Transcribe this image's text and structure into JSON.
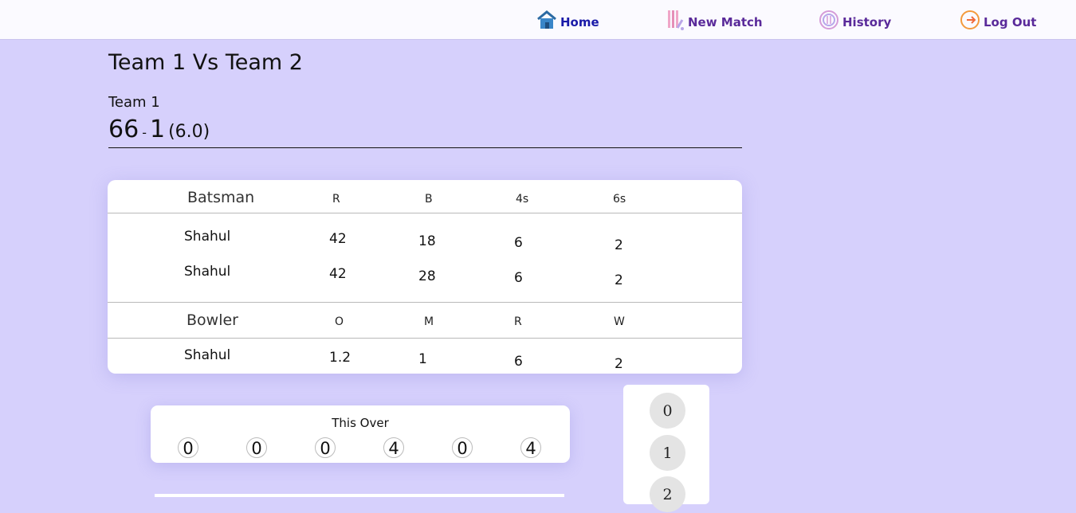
{
  "nav": {
    "home": "Home",
    "new_match": "New Match",
    "history": "History",
    "logout": "Log Out"
  },
  "match": {
    "title": "Team 1 Vs Team 2",
    "batting_team": "Team 1",
    "runs": "66",
    "wickets": "1",
    "overs": "(6.0)"
  },
  "batting": {
    "headers": [
      "Batsman",
      "R",
      "B",
      "4s",
      "6s"
    ],
    "rows": [
      [
        "Shahul",
        "42",
        "18",
        "6",
        "2"
      ],
      [
        "Shahul",
        "42",
        "28",
        "6",
        "2"
      ]
    ]
  },
  "bowling": {
    "headers": [
      "Bowler",
      "O",
      "M",
      "R",
      "W"
    ],
    "rows": [
      [
        "Shahul",
        "1.2",
        "1",
        "6",
        "2"
      ]
    ]
  },
  "this_over": {
    "title": "This Over",
    "balls": [
      "0",
      "0",
      "0",
      "4",
      "0",
      "4"
    ]
  },
  "run_pad": [
    "0",
    "1",
    "2"
  ],
  "icons": {
    "home": "home-icon",
    "new_match": "cricket-bat-icon",
    "history": "cricket-ball-icon",
    "logout": "logout-icon"
  }
}
